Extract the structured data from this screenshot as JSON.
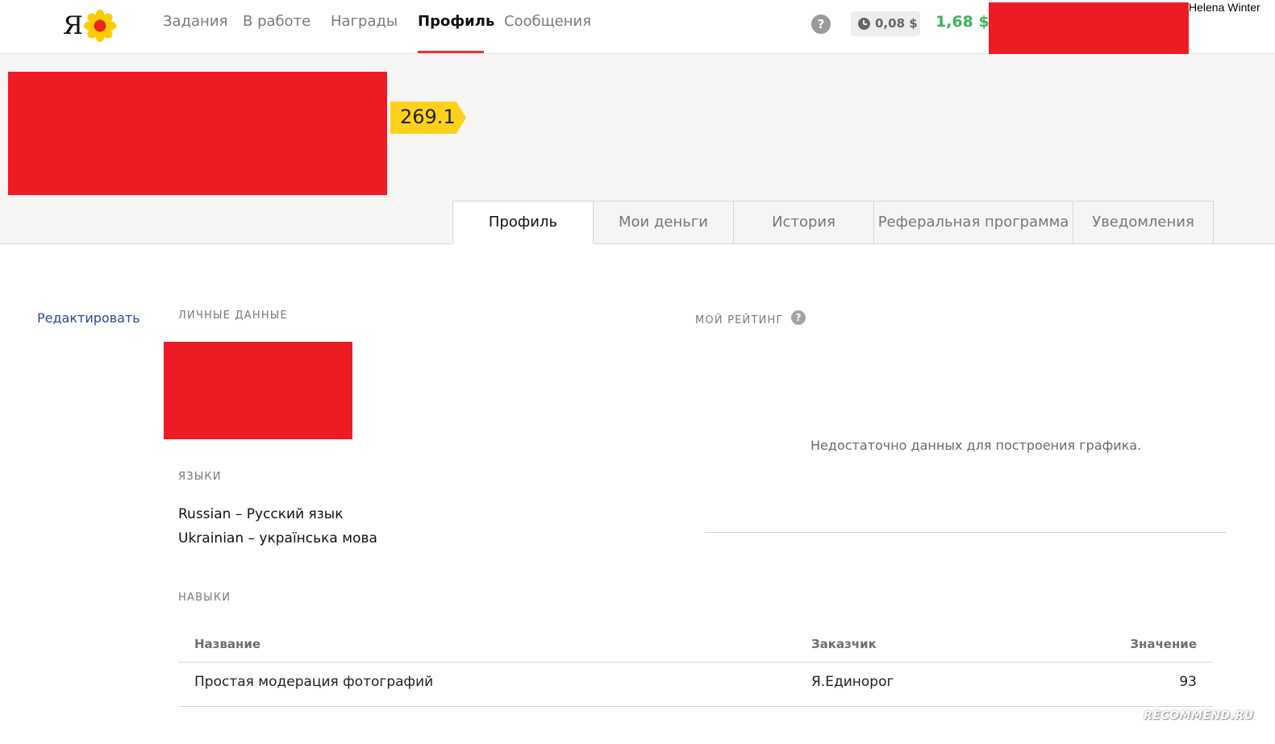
{
  "header": {
    "logo_letter": "Я",
    "nav": [
      {
        "label": "Задания"
      },
      {
        "label": "В работе"
      },
      {
        "label": "Награды"
      },
      {
        "label": "Профиль"
      },
      {
        "label": "Сообщения"
      }
    ],
    "help": "?",
    "pending_amount": "0,08 $",
    "balance": "1,68 $",
    "user_name": "Helena Winter",
    "colors": {
      "accent": "#e63637",
      "balance": "#3cb55b",
      "redacted": "#ed1c24"
    }
  },
  "profile": {
    "rating": "269.1",
    "rating_color": "#ffd11a"
  },
  "tabs": [
    {
      "label": "Профиль"
    },
    {
      "label": "Мои деньги"
    },
    {
      "label": "История"
    },
    {
      "label": "Реферальная программа"
    },
    {
      "label": "Уведомления"
    }
  ],
  "main": {
    "edit_link": "Редактировать",
    "personal_label": "ЛИЧНЫЕ ДАННЫЕ",
    "languages_label": "ЯЗЫКИ",
    "languages": [
      "Russian – Русский язык",
      "Ukrainian – українська мова"
    ],
    "skills_label": "НАВЫКИ",
    "rating_label": "МОЙ РЕЙТИНГ",
    "rating_help": "?",
    "no_data": "Недостаточно данных для построения графика.",
    "skills_table": {
      "headers": [
        "Название",
        "Заказчик",
        "Значение"
      ],
      "rows": [
        [
          "Простая модерация фотографий",
          "Я.Единорог",
          "93"
        ]
      ]
    }
  },
  "watermark": "RECOMMEND.RU"
}
